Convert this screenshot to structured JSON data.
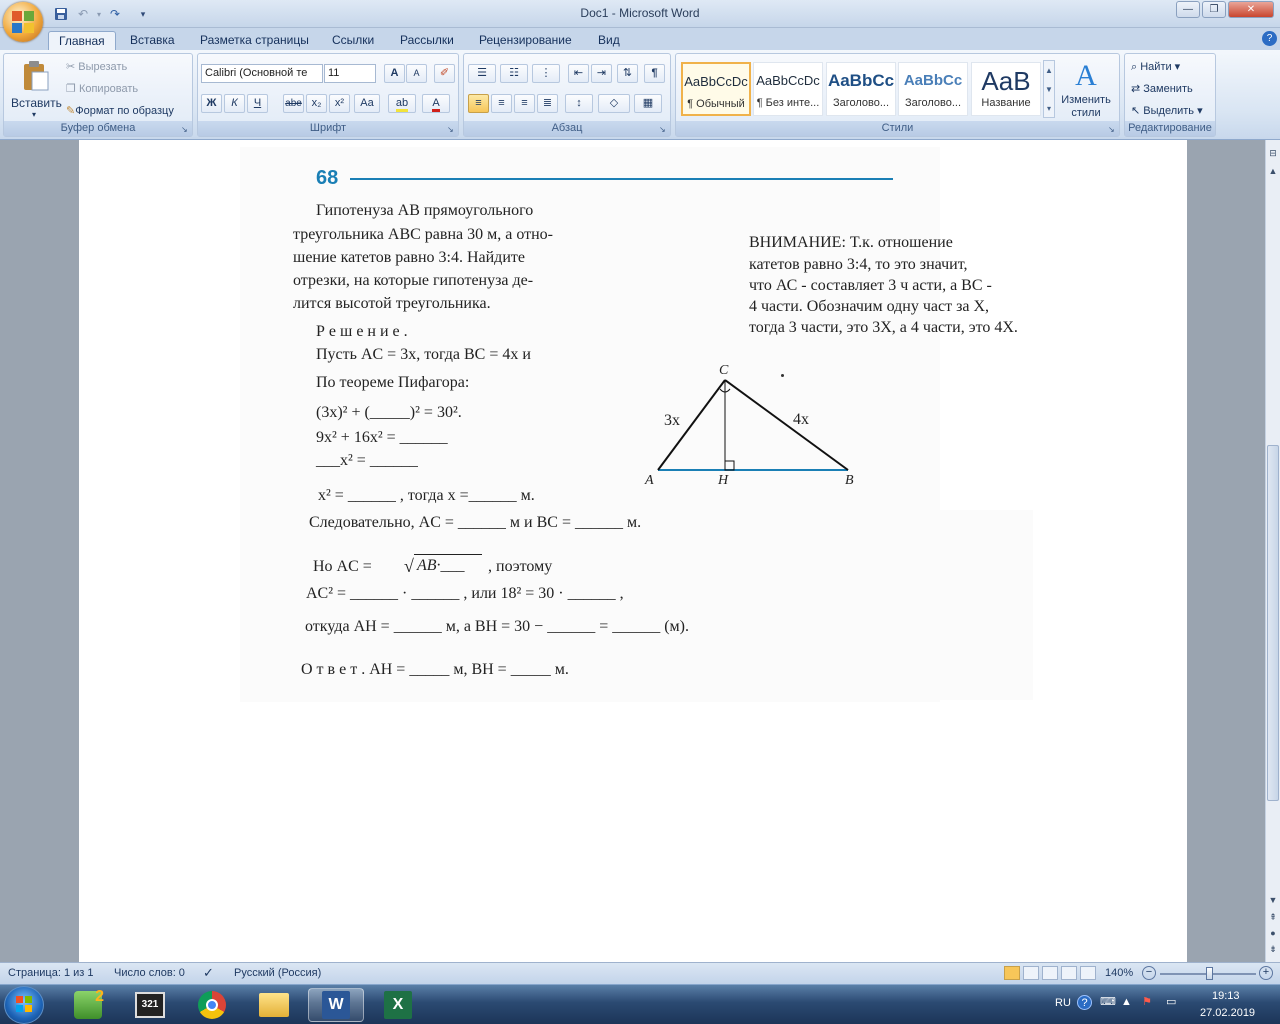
{
  "window": {
    "title": "Doc1 - Microsoft Word",
    "controls": {
      "minimize": "—",
      "restore": "❐",
      "close": "✕"
    },
    "help": "?"
  },
  "qat": {
    "save": "save-icon",
    "undo": "undo-icon",
    "redo": "redo-icon",
    "customize": "▾"
  },
  "tabs": [
    "Главная",
    "Вставка",
    "Разметка страницы",
    "Ссылки",
    "Рассылки",
    "Рецензирование",
    "Вид"
  ],
  "ribbon": {
    "clipboard": {
      "label": "Буфер обмена",
      "paste": "Вставить",
      "paste_arrow": "▾",
      "cut": "Вырезать",
      "copy": "Копировать",
      "format_painter": "Формат по образцу"
    },
    "font": {
      "label": "Шрифт",
      "font_name": "Calibri (Основной те",
      "font_size": "11",
      "bold": "Ж",
      "italic": "К",
      "underline": "Ч",
      "strike": "abe",
      "subscript": "x₂",
      "superscript": "x²",
      "change_case": "Aa",
      "grow": "A",
      "shrink": "A"
    },
    "paragraph": {
      "label": "Абзац",
      "show_marks": "¶"
    },
    "styles": {
      "label": "Стили",
      "items": [
        {
          "preview": "AaBbCcDc",
          "name": "¶ Обычный"
        },
        {
          "preview": "AaBbCcDc",
          "name": "¶ Без инте..."
        },
        {
          "preview": "AaBbCc",
          "name": "Заголово..."
        },
        {
          "preview": "AaBbCc",
          "name": "Заголово..."
        },
        {
          "preview": "AaB",
          "name": "Название"
        }
      ],
      "change_styles": "Изменить стили"
    },
    "editing": {
      "label": "Редактирование",
      "find": "Найти",
      "replace": "Заменить",
      "select": "Выделить"
    }
  },
  "document": {
    "page_number": "68",
    "problem": [
      "Гипотенуза  АВ  прямоугольного",
      "треугольника АВС равна 30 м, а отно-",
      "шение катетов равно 3:4. Найдите",
      "отрезки, на которые гипотенуза де-",
      "лится высотой треугольника."
    ],
    "solution_heading": "Р е ш е н и е .",
    "let_line": "Пусть  AC = 3x,  тогда  BC = 4x   и",
    "pythagoras": "По теореме Пифагора:",
    "eq1": "(3x)² + (_____)² = 30².",
    "eq2": "9x² + 16x² =  ______",
    "eq3": "___x² =    ______",
    "eq4": "x² = ______ , тогда x =______ м.",
    "consequently": "Следовательно,  AC  =  ______  м  и  BC  =  ______  м.",
    "but_line_pre": "Но   AC   =",
    "but_sqrt": "AB·___",
    "but_line_post": ",  поэтому",
    "ac2_line": "AC²  =  ______ · ______ ,  или  18²  =  30 · ______ ,",
    "whence_line": "откуда  AH  =  ______  м,  а  BH = 30 − ______  =  ______  (м).",
    "answer_line": "О т в е т .   AH = _____ м,    BH = _____ м.",
    "note": [
      "ВНИМАНИЕ: Т.к. отношение",
      "катетов равно 3:4, то это значит,",
      "что  АС - составляет 3 ч асти, а ВС -",
      "4 части. Обозначим одну част за Х,",
      "тогда 3 части, это 3Х, а 4 части, это  4Х."
    ],
    "diagram": {
      "C": "C",
      "A": "A",
      "H": "H",
      "B": "B",
      "left_side": "3x",
      "right_side": "4x"
    }
  },
  "status": {
    "page": "Страница: 1 из 1",
    "words": "Число слов: 0",
    "language": "Русский (Россия)",
    "zoom": "140%",
    "zoom_level_percent": 140
  },
  "taskbar": {
    "lang": "RU",
    "time": "19:13",
    "date": "27.02.2019",
    "badge": "2",
    "badge2": "321"
  },
  "colors": {
    "accent": "#1a7fb5",
    "ribbon": "#dbe6f3",
    "taskbar": "#1c3558"
  }
}
